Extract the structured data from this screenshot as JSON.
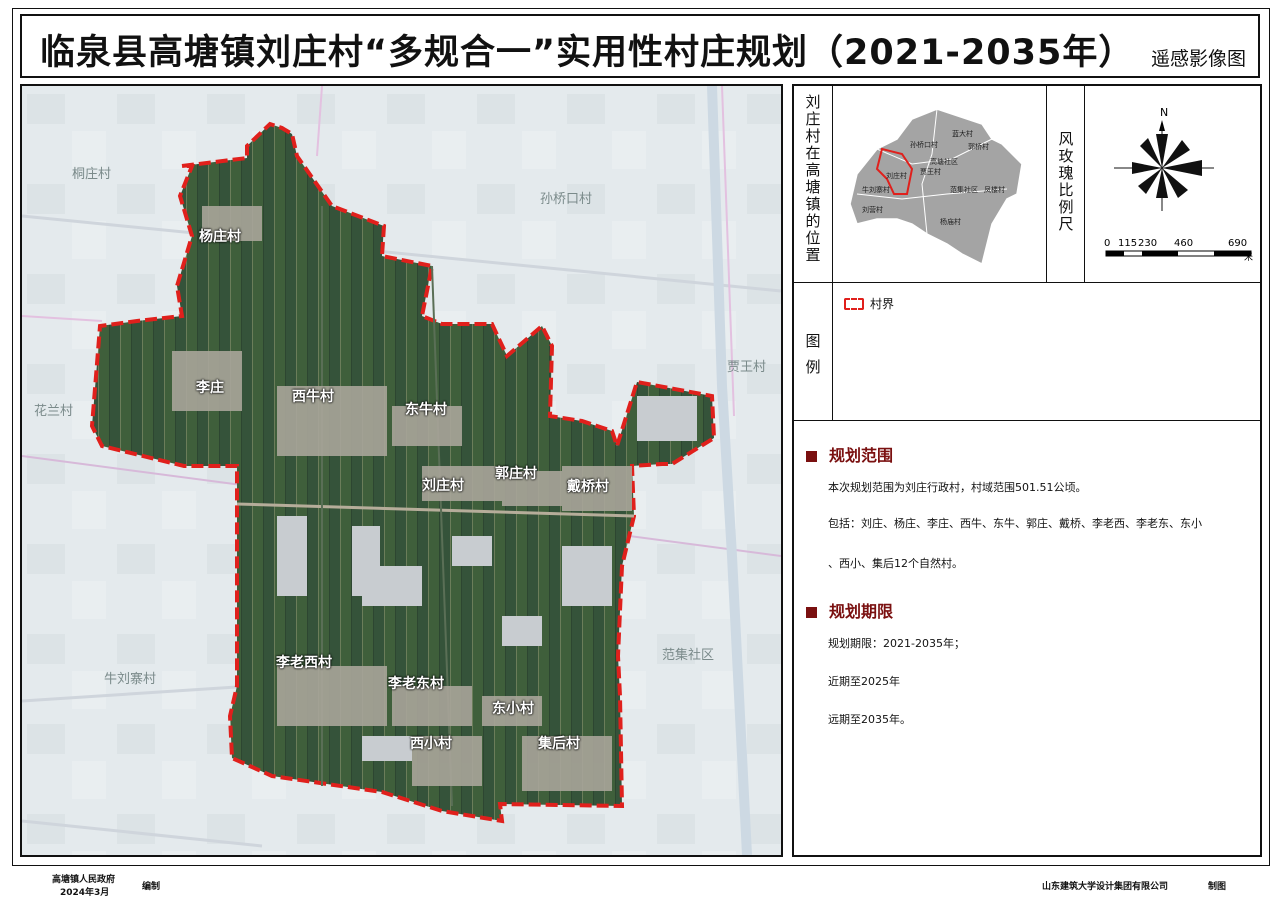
{
  "title": "临泉县高塘镇刘庄村“多规合一”实用性村庄规划（2021-2035年）",
  "map_type": "遥感影像图",
  "map": {
    "village_labels": [
      "杨庄村",
      "李庄",
      "西牛村",
      "东牛村",
      "刘庄村",
      "郭庄村",
      "戴桥村",
      "李老西村",
      "李老东村",
      "东小村",
      "西小村",
      "集后村"
    ],
    "neighbor_labels": [
      "桐庄村",
      "孙桥口村",
      "花兰村",
      "贾王村",
      "牛刘寨村",
      "范集社区"
    ]
  },
  "location": {
    "label": "刘庄村在高塘镇的位置",
    "mini_labels": [
      "蓝大村",
      "孙桥口村",
      "郭桥村",
      "高塘社区",
      "贾王村",
      "刘庄村",
      "牛刘寨村",
      "刘营村",
      "范集社区",
      "杨庙村",
      "凤楼村"
    ]
  },
  "compass": {
    "label": "风玫瑰比例尺",
    "north": "N",
    "scale_ticks": [
      "0",
      "115",
      "230",
      "460",
      "690"
    ],
    "scale_unit": "米"
  },
  "legend": {
    "label": "图例",
    "items": [
      {
        "symbol": "red-dashed-boundary",
        "text": "村界"
      }
    ],
    "boundary_color": "#e0201c"
  },
  "scope": {
    "heading": "规划范围",
    "line1": "本次规划范围为刘庄行政村，村域范围501.51公顷。",
    "line2": "包括：刘庄、杨庄、李庄、西牛、东牛、郭庄、戴桥、李老西、李老东、东小",
    "line3": "、西小、集后12个自然村。"
  },
  "period": {
    "heading": "规划期限",
    "line1": "规划期限：2021-2035年；",
    "line2": "近期至2025年",
    "line3": "远期至2035年。"
  },
  "footer": {
    "org": "高塘镇人民政府",
    "date": "2024年3月",
    "compiled": "编制",
    "designer": "山东建筑大学设计集团有限公司",
    "drawn": "制图"
  },
  "colors": {
    "accent": "#7a1010",
    "field_green": "#3d5f3a",
    "road": "#c9b7d6"
  }
}
